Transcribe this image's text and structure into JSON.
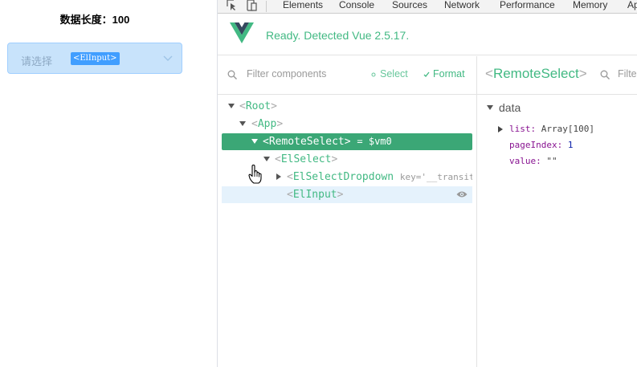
{
  "app": {
    "length_label": "数据长度：100",
    "select": {
      "placeholder": "请选择",
      "tag": "<ElInput>"
    }
  },
  "devtools": {
    "tabs": [
      "Elements",
      "Console",
      "Sources",
      "Network",
      "Performance",
      "Memory",
      "Ap"
    ],
    "vue_status": "Ready. Detected Vue 2.5.17.",
    "components": {
      "filter_placeholder": "Filter components",
      "select_label": "Select",
      "format_label": "Format"
    },
    "tree": [
      {
        "open": "<",
        "name": "Root",
        "close": ">"
      },
      {
        "open": "<",
        "name": "App",
        "close": ">"
      },
      {
        "open": "<",
        "name": "RemoteSelect",
        "close": ">",
        "suffix": "= $vm0"
      },
      {
        "open": "<",
        "name": "ElSelect",
        "close": ">"
      },
      {
        "open": "<",
        "name": "ElSelectDropdown",
        "close": "",
        "key": "key='__transit"
      },
      {
        "open": "<",
        "name": "ElInput",
        "close": ">"
      }
    ],
    "inspector": {
      "open": "<",
      "title": "RemoteSelect",
      "close": ">",
      "filter_placeholder": "Filte",
      "section": "data",
      "props": [
        {
          "key": "list:",
          "value": "Array[100]"
        },
        {
          "key": "pageIndex:",
          "value": "1"
        },
        {
          "key": "value:",
          "value": "\"\""
        }
      ]
    }
  },
  "colors": {
    "vue_green": "#42b983",
    "selected_row": "#3ba776",
    "hover_row": "#e5f2fc"
  }
}
